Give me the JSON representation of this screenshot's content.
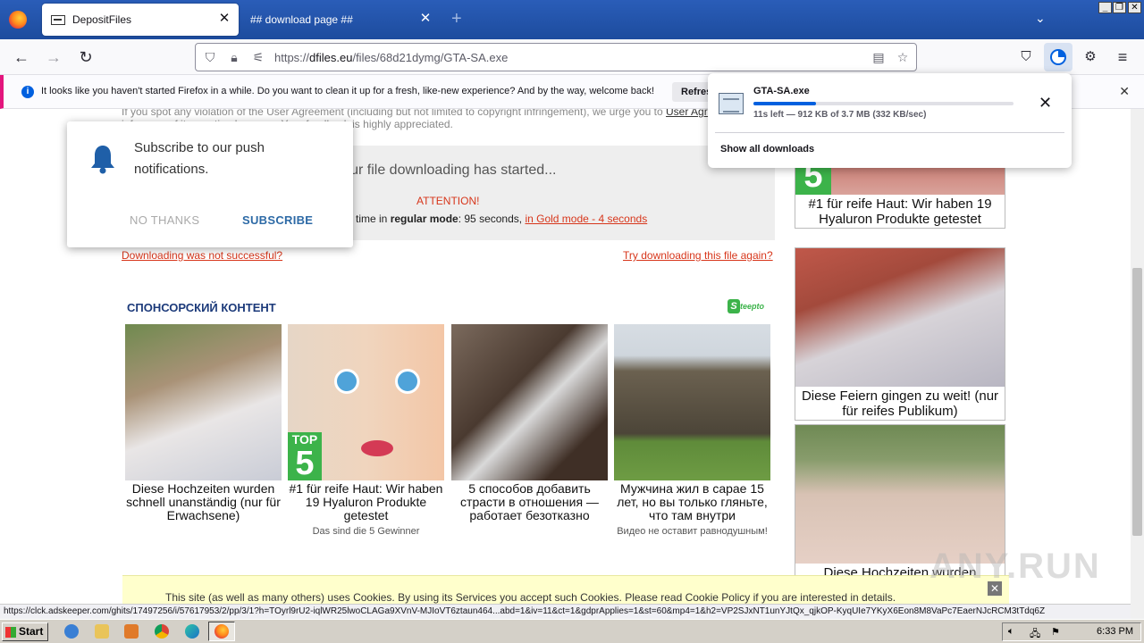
{
  "browser": {
    "tabs": [
      {
        "label": "DepositFiles",
        "active": true
      },
      {
        "label": "## download page ##",
        "active": false
      }
    ],
    "url": {
      "host": "dfiles.eu",
      "path": "/files/68d21dymg/GTA-SA.exe",
      "scheme": "https://"
    },
    "notification": {
      "message": "It looks like you haven't started Firefox in a while. Do you want to clean it up for a fresh, like-new experience? And by the way, welcome back!",
      "button": "Refresh Firefox…"
    },
    "status_url": "https://clck.adskeeper.com/ghits/17497256/i/57617953/2/pp/3/1?h=TOyrl9rU2-iqlWR25lwoCLAGa9XVnV-MJIoVT6ztaun464...abd=1&iv=11&ct=1&gdprApplies=1&st=60&mp4=1&h2=VP2SJxNT1unYJtQx_qjkOP-KyqUIe7YKyX6Eon8M8VaPc7EaerNJcRCM3tTdq6Z"
  },
  "downloads": {
    "file_name": "GTA-SA.exe",
    "progress": 0.24,
    "status": "11s left — 912 KB of 3.7 MB (332 KB/sec)",
    "show_all": "Show all downloads"
  },
  "push": {
    "message": "Subscribe to our push notifications.",
    "no": "NO THANKS",
    "yes": "SUBSCRIBE"
  },
  "page": {
    "top_text_1": "If you spot any violation of the User Agreement (including but not limited to copyright infringement), we urge you to",
    "top_link": "User Agreement",
    "top_text_2": "inform us of it so action by users. Your feedback is highly appreciated.",
    "download_started": "Your file downloading has started...",
    "attention": "ATTENTION!",
    "wait_prefix": "time in",
    "regular_mode": "regular mode",
    "regular_value": ": 95 seconds,",
    "gold_link": "in Gold mode - 4 seconds",
    "not_successful": "Downloading was not successful?",
    "try_again": "Try downloading this file again?",
    "sponsor_title": "СПОНСОРСКИЙ КОНТЕНТ",
    "sponsor_brand": "Steepto",
    "cards": [
      {
        "title": "Diese Hochzeiten wurden schnell unanständig (nur für Erwachsene)",
        "sub": "",
        "color": "#8a7a6a"
      },
      {
        "title": "#1 für reife Haut: Wir haben 19 Hyaluron Produkte getestet",
        "sub": "Das sind die 5 Gewinner",
        "color": "#e9c7a8"
      },
      {
        "title": "5 способов добавить страсти в отношения — работает безотказно",
        "sub": "",
        "color": "#5b4a3e"
      },
      {
        "title": "Мужчина жил в сарае 15 лет, но вы только гляньте, что там внутри",
        "sub": "Видео не оставит равнодушным!",
        "color": "#6f6a55"
      }
    ],
    "right_cards": [
      {
        "title": "#1 für reife Haut: Wir haben 19 Hyaluron Produkte getestet"
      },
      {
        "title": "Diese Feiern gingen zu weit! (nur für reifes Publikum)"
      },
      {
        "title": "Diese Hochzeiten wurden"
      }
    ],
    "cookie": "This site (as well as many others) uses Cookies. By using its Services you accept such Cookies. Please read Cookie Policy if you are interested in details.",
    "badge_top": "TOP",
    "badge_num": "5"
  },
  "taskbar": {
    "start": "Start",
    "time": "6:33 PM"
  },
  "watermark": "ANY.RUN"
}
